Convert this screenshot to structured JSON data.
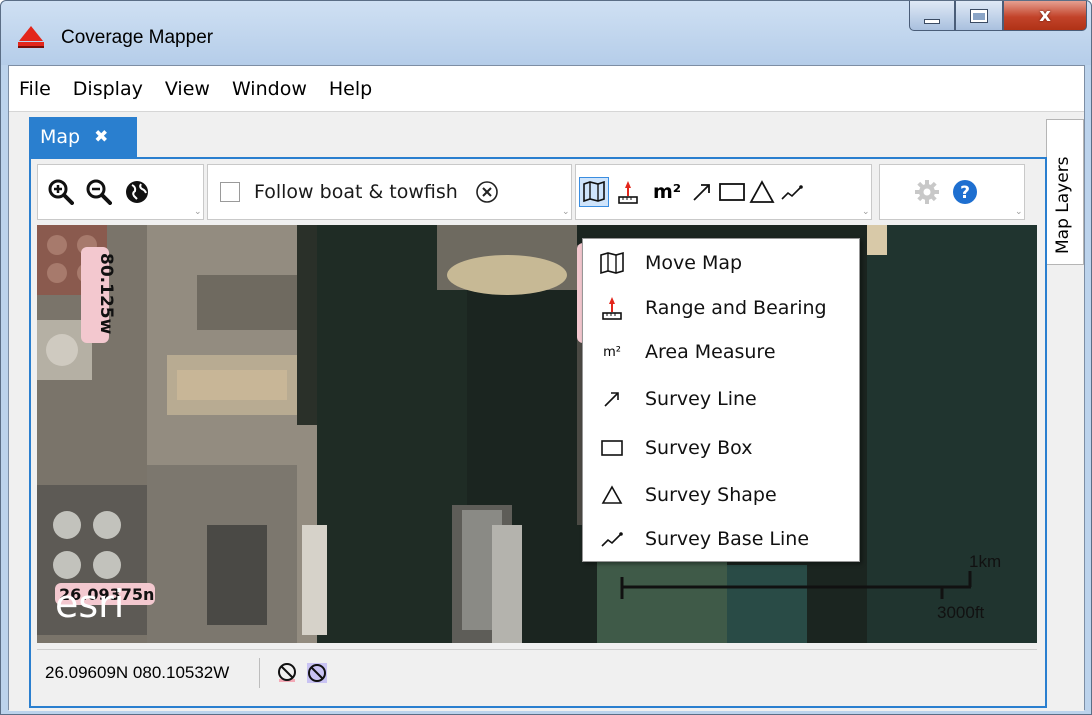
{
  "window": {
    "title": "Coverage Mapper",
    "close_glyph": "x",
    "colors": {
      "frame": "#bcd3ec",
      "accent": "#2a7fcf",
      "close": "#c2432a"
    }
  },
  "menu": {
    "items": [
      {
        "label": "File"
      },
      {
        "label": "Display"
      },
      {
        "label": "View"
      },
      {
        "label": "Window"
      },
      {
        "label": "Help"
      }
    ]
  },
  "tabs": {
    "map": {
      "label": "Map",
      "close_glyph": "✖"
    },
    "side": {
      "label": "Map Layers"
    }
  },
  "toolbar": {
    "navigation_icons": [
      "zoom-in-icon",
      "zoom-out-icon",
      "globe-icon"
    ],
    "follow_label": "Follow boat & towfish",
    "follow_checked": false,
    "area_label": "m²",
    "tool_icons": [
      "map-icon",
      "range-bearing-icon",
      "area-measure-icon",
      "arrow-icon",
      "rectangle-icon",
      "triangle-icon",
      "baseline-icon"
    ],
    "right_icons": [
      "gear-icon",
      "help-icon"
    ]
  },
  "map": {
    "attribution": "esri",
    "grid_label_lon": "80.125w",
    "grid_label_lat": "26.09375n",
    "scale_top": "1km",
    "scale_bottom": "3000ft"
  },
  "dropdown": {
    "items": [
      {
        "label": "Move Map",
        "icon": "map-icon"
      },
      {
        "label": "Range and Bearing",
        "icon": "range-bearing-icon"
      },
      {
        "label": "Area Measure",
        "icon": "area-measure-icon",
        "icon_text": "m²"
      },
      {
        "label": "Survey Line",
        "icon": "arrow-icon"
      },
      {
        "label": "Survey Box",
        "icon": "rectangle-icon"
      },
      {
        "label": "Survey Shape",
        "icon": "triangle-icon"
      },
      {
        "label": "Survey Base Line",
        "icon": "baseline-icon"
      }
    ]
  },
  "status": {
    "coordinates": "26.09609N 080.10532W",
    "icons": [
      "no-signal-icon",
      "no-towfish-icon"
    ]
  }
}
